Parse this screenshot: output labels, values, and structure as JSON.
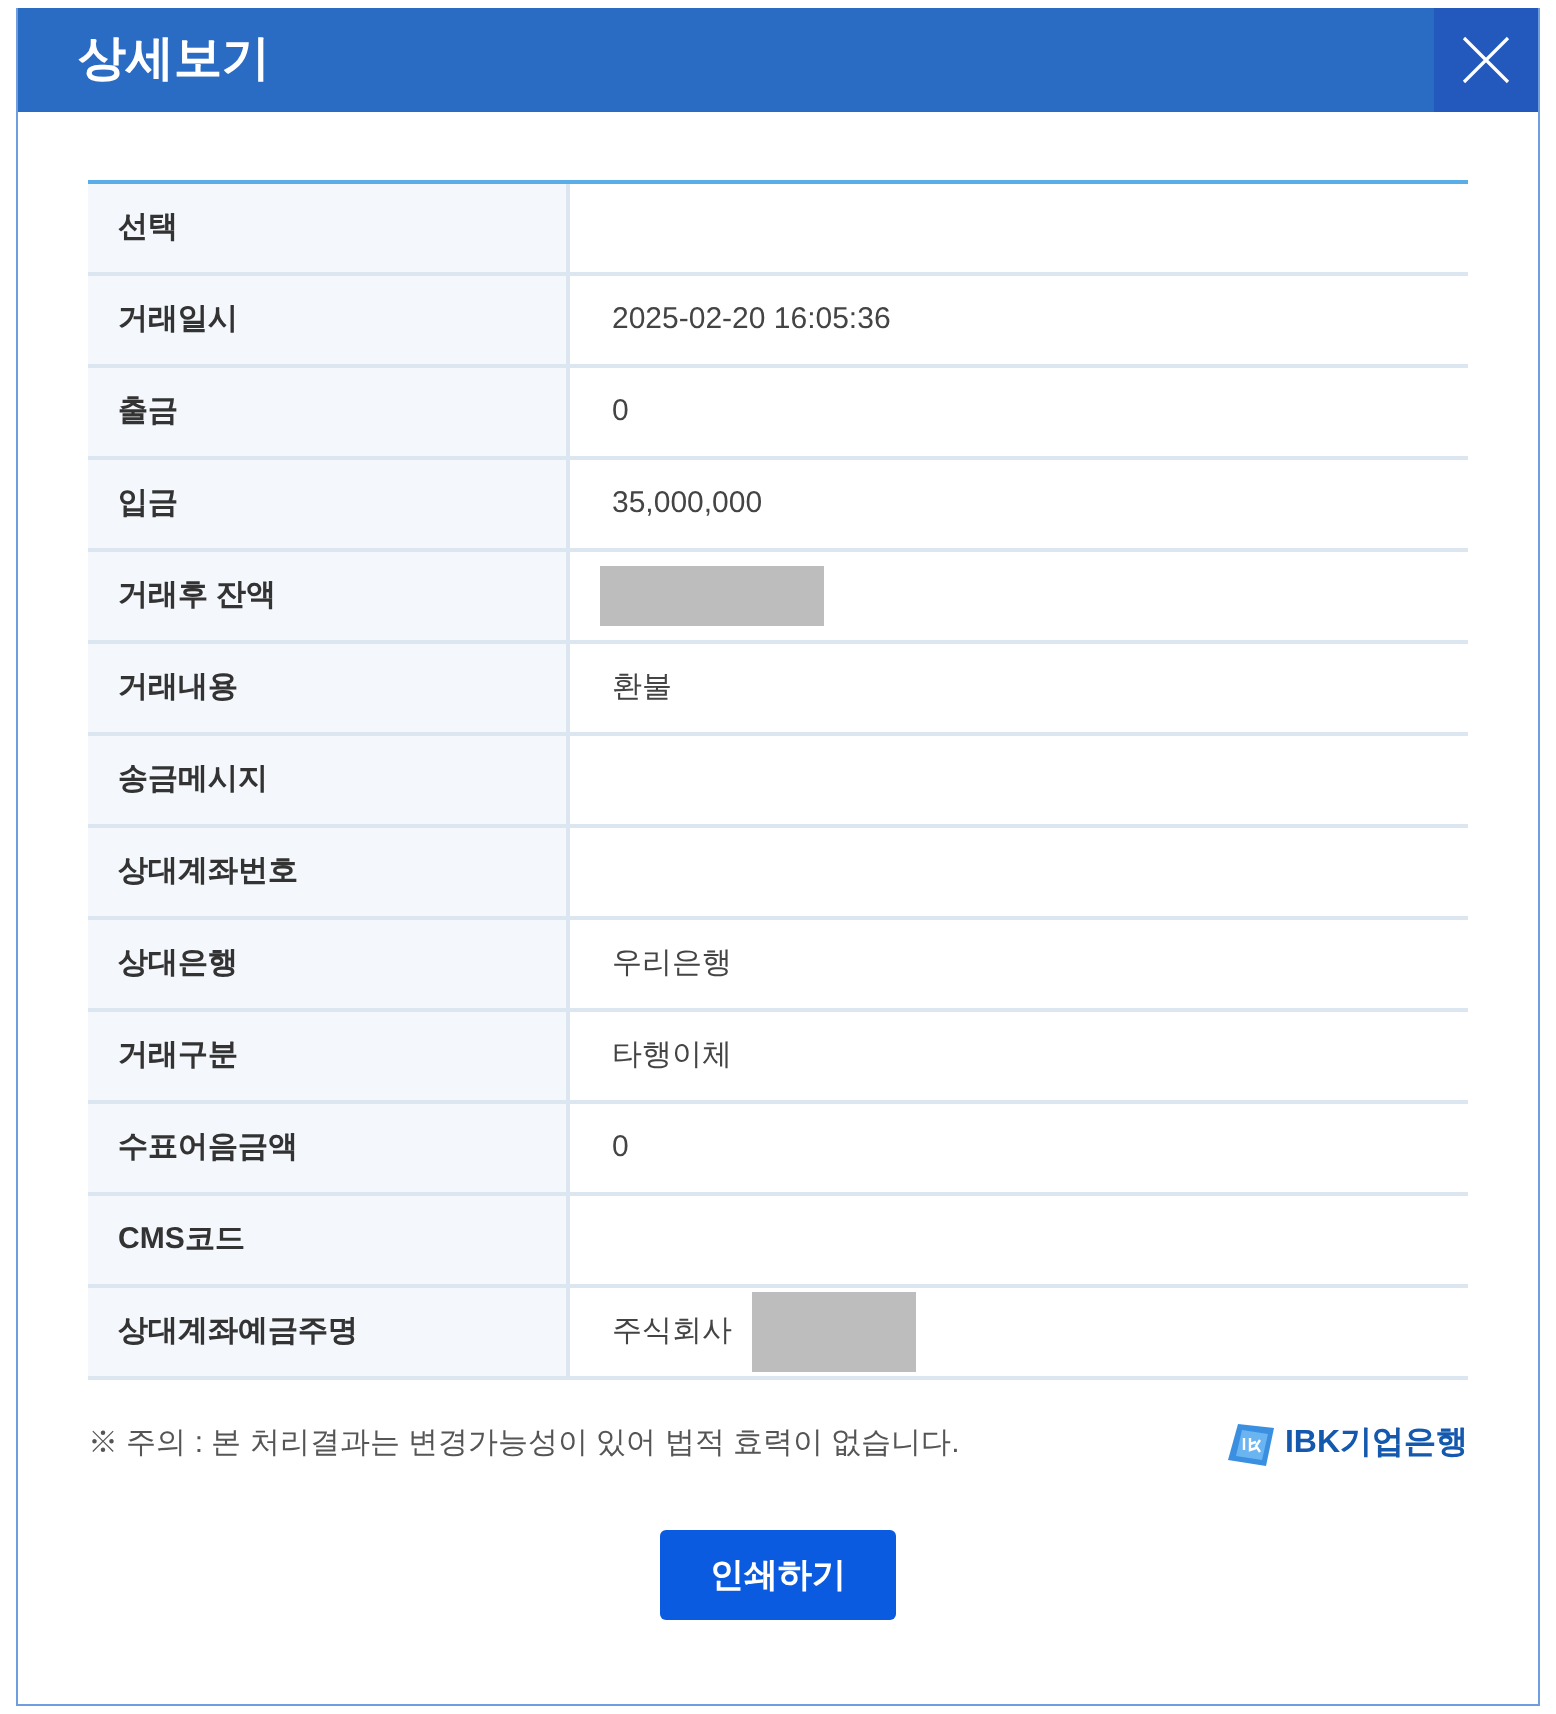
{
  "window": {
    "title": "상세보기"
  },
  "details": {
    "rows": [
      {
        "label": "선택",
        "redacted": false
      },
      {
        "label": "거래일시",
        "value": "2025-02-20 16:05:36",
        "redacted": false
      },
      {
        "label": "출금",
        "value": "0",
        "redacted": false
      },
      {
        "label": "입금",
        "value": "35,000,000",
        "redacted": false
      },
      {
        "label": "거래후 잔액",
        "redacted": true
      },
      {
        "label": "거래내용",
        "value": "환불",
        "redacted": false
      },
      {
        "label": "송금메시지",
        "redacted": false
      },
      {
        "label": "상대계좌번호",
        "redacted": false
      },
      {
        "label": "상대은행",
        "value": "우리은행",
        "redacted": false
      },
      {
        "label": "거래구분",
        "value": "타행이체",
        "redacted": false
      },
      {
        "label": "수표어음금액",
        "value": "0",
        "redacted": false
      },
      {
        "label": "CMS코드",
        "redacted": false
      },
      {
        "label": "상대계좌예금주명",
        "value": "주식회사",
        "redacted": true
      }
    ]
  },
  "notice": "※ 주의 : 본 처리결과는 변경가능성이 있어 법적 효력이 없습니다.",
  "logo": {
    "text": "IBK기업은행"
  },
  "print_button": {
    "label": "인쇄하기"
  }
}
